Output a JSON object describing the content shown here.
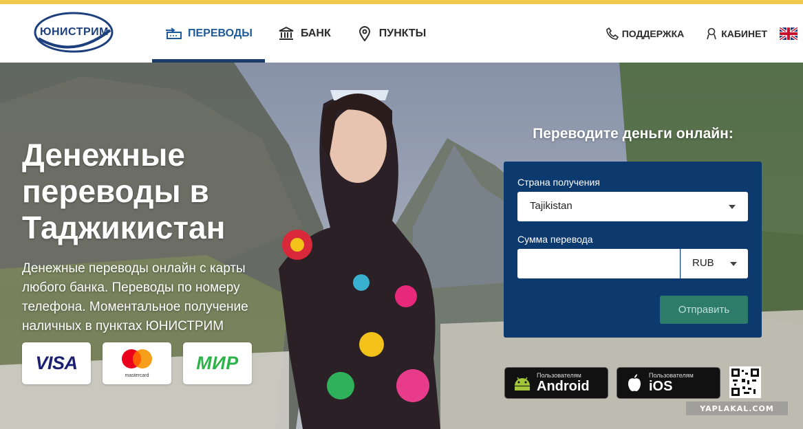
{
  "header": {
    "logo_text": "ЮНИСТРИМ",
    "nav": [
      {
        "label": "ПЕРЕВОДЫ",
        "icon": "transfer-icon",
        "active": true
      },
      {
        "label": "БАНК",
        "icon": "bank-icon",
        "active": false
      },
      {
        "label": "ПУНКТЫ",
        "icon": "map-pin-icon",
        "active": false
      }
    ],
    "support_label": "ПОДДЕРЖКА",
    "cabinet_label": "КАБИНЕТ",
    "language_icon": "uk-flag-icon"
  },
  "hero": {
    "title": "Денежные переводы в Таджикистан",
    "subtitle": "Денежные переводы онлайн с карты любого банка. Переводы по номеру телефона. Моментальное получение наличных в пунктах ЮНИСТРИМ",
    "cards": {
      "visa": "VISA",
      "mastercard": "mastercard",
      "mir": "МИР"
    }
  },
  "form": {
    "title": "Переводите деньги онлайн:",
    "country_label": "Страна получения",
    "country_value": "Tajikistan",
    "amount_label": "Сумма перевода",
    "amount_value": "",
    "currency_value": "RUB",
    "send_label": "Отправить"
  },
  "apps": {
    "android_small": "Пользователям",
    "android_big": "Android",
    "ios_small": "Пользователям",
    "ios_big": "iOS"
  },
  "watermark": "YAPLAKAL.COM",
  "colors": {
    "accent_stripe": "#f2c94c",
    "brand_blue": "#1d3f7d",
    "form_bg": "#0d3a6e",
    "send_button": "#2d7c6a"
  }
}
